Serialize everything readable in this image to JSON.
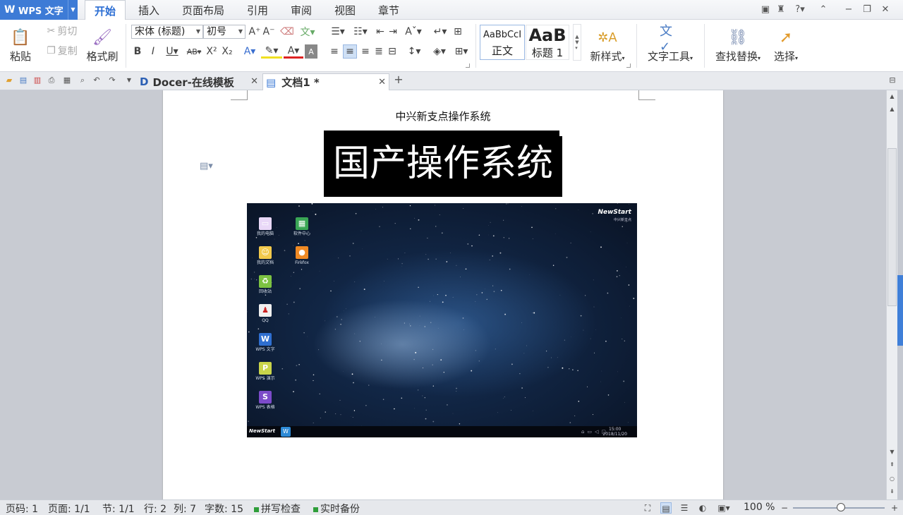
{
  "app": {
    "name": "WPS 文字"
  },
  "menu": [
    "开始",
    "插入",
    "页面布局",
    "引用",
    "审阅",
    "视图",
    "章节"
  ],
  "window_controls": {
    "help": "?"
  },
  "ribbon": {
    "clipboard": {
      "paste": "粘贴",
      "cut": "剪切",
      "copy": "复制",
      "format_painter": "格式刷"
    },
    "font": {
      "family": "宋体 (标题)",
      "size": "初号"
    },
    "styles": [
      {
        "preview": "AaBbCcI",
        "label": "正文"
      },
      {
        "preview": "AaB",
        "label": "标题 1"
      }
    ],
    "new_style": "新样式",
    "text_tools": "文字工具",
    "find_replace": "查找替换",
    "select": "选择"
  },
  "tabs": [
    {
      "label": "Docer-在线模板",
      "active": false
    },
    {
      "label": "文档1 *",
      "active": true
    }
  ],
  "document": {
    "subtitle": "中兴新支点操作系统",
    "title": "国产操作系统",
    "image": {
      "brand": "NewStart",
      "brand_sub": "中兴新支点",
      "desktop_icons": [
        {
          "label": "我的电脑",
          "icon": "computer-icon",
          "glyph": "▭",
          "color": "#e9d8f7"
        },
        {
          "label": "软件中心",
          "icon": "software-center-icon",
          "glyph": "▦",
          "color": "#3aa655"
        },
        {
          "label": "我的文档",
          "icon": "documents-icon",
          "glyph": "☺",
          "color": "#f2c94c"
        },
        {
          "label": "Firefox",
          "icon": "firefox-icon",
          "glyph": "●",
          "color": "#f08a24"
        },
        {
          "label": "回收站",
          "icon": "recycle-bin-icon",
          "glyph": "♻",
          "color": "#7cc242"
        },
        {
          "label": "QQ",
          "icon": "qq-icon",
          "glyph": "♟",
          "color": "#f0f0f0"
        },
        {
          "label": "WPS 文字",
          "icon": "wps-writer-icon",
          "glyph": "W",
          "color": "#2f6fd0"
        },
        {
          "label": "WPS 演示",
          "icon": "wps-presentation-icon",
          "glyph": "P",
          "color": "#c9d44a"
        },
        {
          "label": "WPS 表格",
          "icon": "wps-spreadsheet-icon",
          "glyph": "S",
          "color": "#7c4bc9"
        }
      ],
      "clock_time": "15:00",
      "clock_date": "2018/11/20"
    }
  },
  "status": {
    "page_code": "页码: 1",
    "pages": "页面: 1/1",
    "section": "节: 1/1",
    "row": "行: 2",
    "col": "列: 7",
    "word_count": "字数: 15",
    "spell_check": "拼写检查",
    "backup": "实时备份",
    "zoom": "100 %"
  },
  "colors": {
    "accent": "#3d7bd6",
    "page": "#ffffff",
    "workspace": "#c8cbd2"
  }
}
